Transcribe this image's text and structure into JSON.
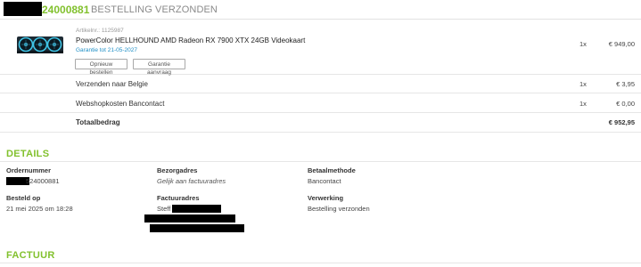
{
  "header": {
    "order_number": "24000881",
    "status": "BESTELLING VERZONDEN"
  },
  "product": {
    "article_nr": "Artikelnr.: 1125987",
    "name": "PowerColor HELLHOUND AMD Radeon RX 7900 XTX 24GB Videokaart",
    "warranty": "Garantie tot 21-05-2027",
    "reorder_label": "Opnieuw bestellen",
    "warranty_request_label": "Garantie aanvraag",
    "qty": "1x",
    "price": "€ 949,00",
    "image_icon": "graphics-card-image"
  },
  "lines": [
    {
      "label": "Verzenden naar Belgie",
      "qty": "1x",
      "price": "€ 3,95"
    },
    {
      "label": "Webshopkosten Bancontact",
      "qty": "1x",
      "price": "€ 0,00"
    }
  ],
  "total": {
    "label": "Totaalbedrag",
    "price": "€ 952,95"
  },
  "details": {
    "title": "DETAILS",
    "order_number_label": "Ordernummer",
    "order_number_value": "524000881",
    "delivery_label": "Bezorgadres",
    "delivery_value": "Gelijk aan factuuradres",
    "payment_label": "Betaalmethode",
    "payment_value": "Bancontact",
    "ordered_label": "Besteld op",
    "ordered_value": "21 mei 2025 om 18:28",
    "invoice_address_label": "Factuuradres",
    "invoice_address_value": "Steff",
    "processing_label": "Verwerking",
    "processing_value": "Bestelling verzonden"
  },
  "invoice": {
    "title": "FACTUUR"
  },
  "colors": {
    "accent": "#82c12e",
    "link": "#1f8fc6",
    "redaction": "#000000"
  }
}
